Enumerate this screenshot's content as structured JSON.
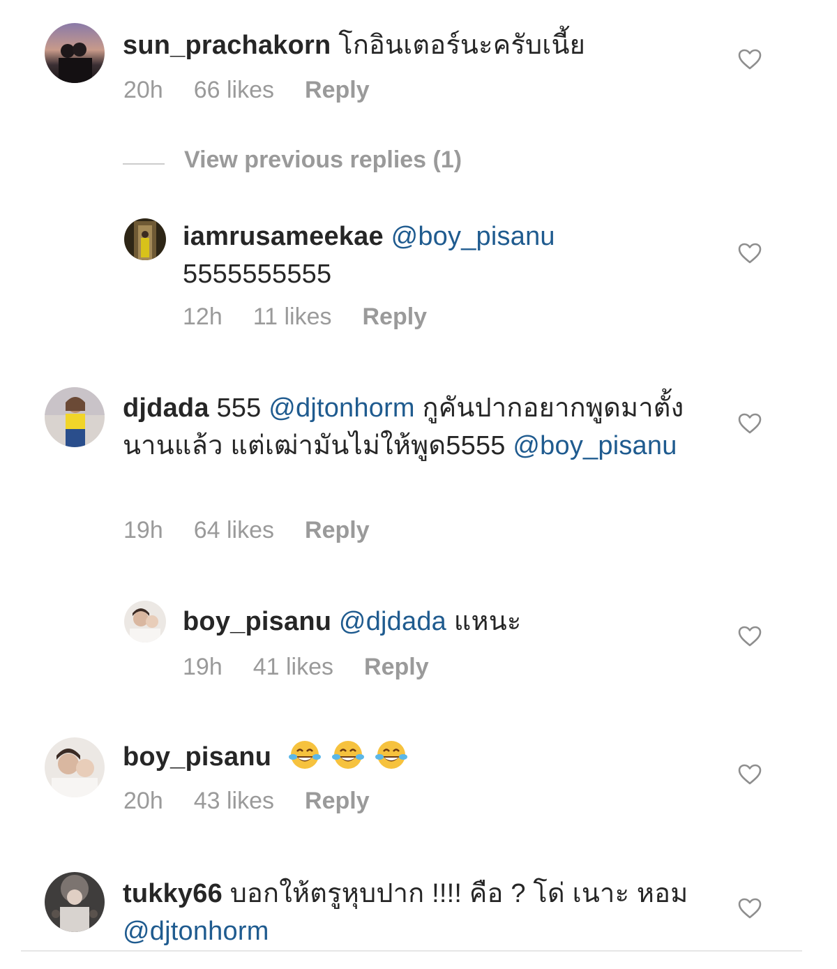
{
  "comments": [
    {
      "username": "sun_prachakorn",
      "text": "โกอินเตอร์นะครับเนี้ย",
      "time": "20h",
      "likes": "66 likes",
      "reply": "Reply"
    },
    {
      "username": "iamrusameekae",
      "mention": "@boy_pisanu",
      "text": "5555555555",
      "time": "12h",
      "likes": "11 likes",
      "reply": "Reply"
    },
    {
      "username": "djdada",
      "text_a": "555",
      "mention": "@djtonhorm",
      "text_b": "กูคันปากอยากพูดมาตั้งนานแล้ว แต่เฒ่ามันไม่ให้พูด5555",
      "mention2": "@boy_pisanu",
      "time": "19h",
      "likes": "64 likes",
      "reply": "Reply"
    },
    {
      "username": "boy_pisanu",
      "mention": "@djdada",
      "text": "แหนะ",
      "time": "19h",
      "likes": "41 likes",
      "reply": "Reply"
    },
    {
      "username": "boy_pisanu",
      "emoji": [
        "face-with-tears-of-joy-icon",
        "face-with-tears-of-joy-icon",
        "face-with-tears-of-joy-icon"
      ],
      "time": "20h",
      "likes": "43 likes",
      "reply": "Reply"
    },
    {
      "username": "tukky66",
      "text": "บอกให้ตรูหุบปาก !!!! คือ ? โด่ เนาะ หอม",
      "mention": "@djtonhorm"
    }
  ],
  "view_previous_replies": "View previous replies (1)",
  "colors": {
    "text": "#262626",
    "muted": "#9a9a9a",
    "mention": "#1f5b8f"
  }
}
